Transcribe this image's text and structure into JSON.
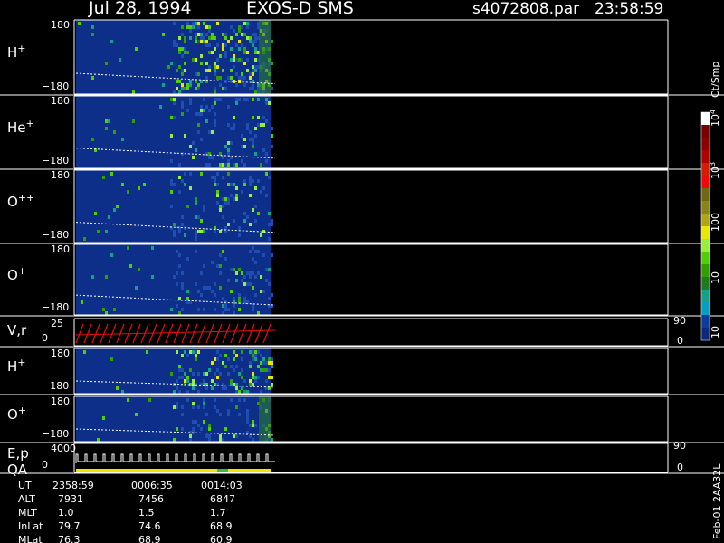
{
  "header": {
    "date": "Jul 28, 1994",
    "mission": "EXOS-D SMS",
    "file": "s4072808.par",
    "time": "23:58:59"
  },
  "footer_label": "Feb-01 2AA32L",
  "colorbar": {
    "unit_label": "Ct/Smp",
    "tick_labels": [
      "10",
      "10",
      "100",
      "10",
      "10",
      "1"
    ],
    "tick_sup": [
      "4",
      "3",
      "",
      "",
      "",
      ""
    ],
    "tick_values": [
      10000,
      1000,
      100,
      10,
      1,
      0.5
    ],
    "colors": [
      "#ffffff",
      "#7a0000",
      "#8e0000",
      "#b00000",
      "#d61d00",
      "#ee0a0a",
      "#6f6a10",
      "#8a8416",
      "#b0a514",
      "#e9e600",
      "#98ee3a",
      "#50d000",
      "#2ea000",
      "#1f7a20",
      "#15a08a",
      "#00a0c0",
      "#0d3ca0",
      "#0b2a7c"
    ]
  },
  "panels": [
    {
      "label": "H",
      "sup": "+",
      "ytop": "180",
      "ybot": "−180"
    },
    {
      "label": "He",
      "sup": "+",
      "ytop": "180",
      "ybot": "−180"
    },
    {
      "label": "O",
      "sup": "++",
      "ytop": "180",
      "ybot": "−180"
    },
    {
      "label": "O",
      "sup": "+",
      "ytop": "180",
      "ybot": "−180"
    },
    {
      "label": "V,r",
      "sup": "",
      "ytop": "25",
      "ybot": "0",
      "rtop": "90",
      "rbot": "0"
    },
    {
      "label": "H",
      "sup": "+",
      "ytop": "180",
      "ybot": "−180"
    },
    {
      "label": "O",
      "sup": "+",
      "ytop": "180",
      "ybot": "−180"
    },
    {
      "label": "E,p",
      "label2": "QA",
      "sup": "",
      "ytop": "4000",
      "ybot": "0",
      "rtop": "90",
      "rbot": "0"
    }
  ],
  "ephemeris": {
    "rows": [
      "UT",
      "ALT",
      "MLT",
      "InLat",
      "MLat"
    ],
    "columns": [
      [
        "2358:59",
        "7931",
        "1.0",
        "79.7",
        "76.3"
      ],
      [
        "0006:35",
        "7456",
        "1.5",
        "74.6",
        "68.9"
      ],
      [
        "0014:03",
        "6847",
        "1.7",
        "68.9",
        "60.9"
      ]
    ]
  },
  "chart_data": {
    "type": "heatmap",
    "title": "Jul 28, 1994   EXOS-D SMS",
    "x": [
      "2358:59",
      "0006:35",
      "0014:03"
    ],
    "panels": [
      "H+",
      "He+",
      "O++",
      "O+",
      "V,r",
      "H+",
      "O+",
      "E,p QA"
    ],
    "ylim": [
      -180,
      180
    ],
    "colorbar_ticks": [
      10000,
      1000,
      100,
      10,
      1
    ],
    "colorbar_unit": "Ct/Smp",
    "ephemeris": {
      "UT": [
        "2358:59",
        "0006:35",
        "0014:03"
      ],
      "ALT": [
        7931,
        7456,
        6847
      ],
      "MLT": [
        1.0,
        1.5,
        1.7
      ],
      "InLat": [
        79.7,
        74.6,
        68.9
      ],
      "MLat": [
        76.3,
        68.9,
        60.9
      ]
    }
  }
}
